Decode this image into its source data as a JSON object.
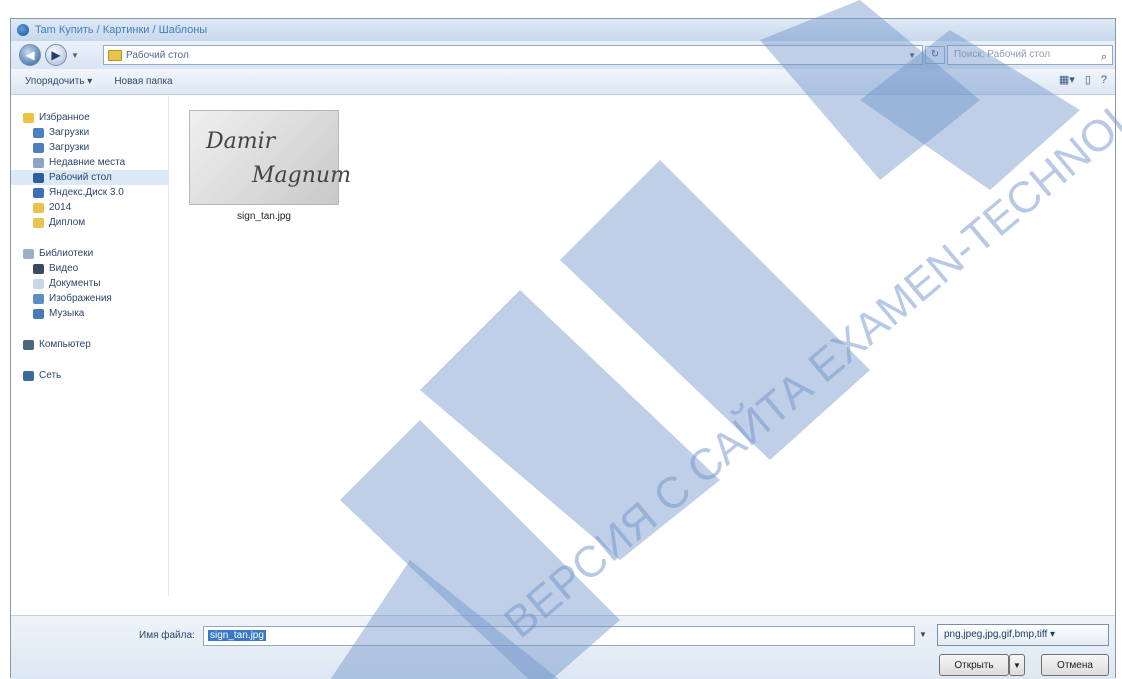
{
  "window": {
    "title": "Tam Купить / Картинки / Шаблоны"
  },
  "nav": {
    "address": "Рабочий стол",
    "search_placeholder": "Поиск: Рабочий стол"
  },
  "toolbar": {
    "organize": "Упорядочить ▾",
    "new_folder": "Новая папка"
  },
  "sidebar": {
    "favorites_header": "Избранное",
    "favorites": [
      "Загрузки",
      "Недавние места",
      "Рабочий стол",
      "Яндекс.Диск 3.0",
      "2014",
      "Диплом"
    ],
    "favorites_first": "Избранное",
    "libraries_header": "Библиотеки",
    "libraries": [
      "Видео",
      "Документы",
      "Изображения",
      "Музыка"
    ],
    "computer": "Компьютер",
    "network": "Сеть"
  },
  "files": [
    {
      "name": "sign_tan.jpg",
      "thumb_line1": "Damir",
      "thumb_line2": "Magnum"
    }
  ],
  "bottom": {
    "filename_label": "Имя файла:",
    "filename_value": "sign_tan.jpg",
    "filter": "png,jpeg,jpg,gif,bmp,tiff ▾",
    "open": "Открыть",
    "cancel": "Отмена"
  },
  "watermark": {
    "text": "ВЕРСИЯ С САЙТА EXAMEN-TECHNOLAB",
    "color": "#6f94c9"
  }
}
